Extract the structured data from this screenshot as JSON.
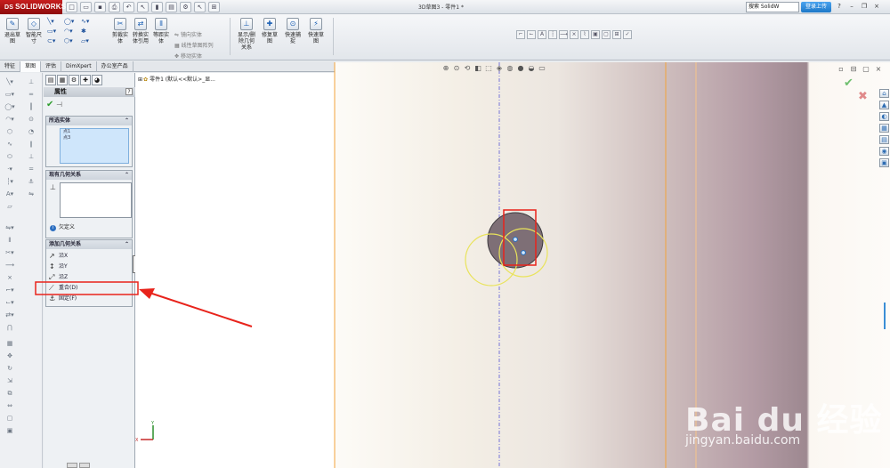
{
  "titlebar": {
    "logo_prefix": "DS",
    "logo_text": "SOLIDWORKS",
    "window_title": "3D草图3 - 零件1 *",
    "search_placeholder": "搜索 SolidW",
    "signin_label": "登录上传",
    "help_label": "?",
    "minimize_label": "–",
    "restore_label": "❐",
    "close_label": "×"
  },
  "command_manager": {
    "sketch_exit": "退出草图",
    "smart_dim": "智能尺寸",
    "trim": "剪裁实体",
    "convert": "转换实体引用",
    "offset": "等距实体",
    "mirror": "镜向实体",
    "linear_pattern": "线性草图阵列",
    "move": "移动实体",
    "relations": "显示/删除几何关系",
    "repair": "修复草图",
    "quick_snap": "快速捕捉",
    "rapid_sketch": "快速草图"
  },
  "tabs": [
    "特征",
    "草图",
    "评估",
    "DimXpert",
    "办公室产品"
  ],
  "active_tab": 1,
  "property_manager": {
    "title": "属性",
    "selected_group": {
      "header": "所选实体",
      "items": [
        "点1",
        "点3"
      ]
    },
    "existing_group": {
      "header": "现有几何关系",
      "status": "欠定义"
    },
    "add_group": {
      "header": "添加几何关系",
      "items": [
        "沿X",
        "沿Y",
        "沿Z",
        "重合(D)",
        "固定(F)"
      ]
    }
  },
  "feature_tree": {
    "root": "零件1 (默认<<默认>_显..."
  },
  "watermark": {
    "brand": "Bai du 经验",
    "url": "jingyan.baidu.com"
  },
  "colors": {
    "annotation_red": "#e8231b",
    "point_blue": "#1f6fc5",
    "circle_yellow": "#e9e35a"
  }
}
